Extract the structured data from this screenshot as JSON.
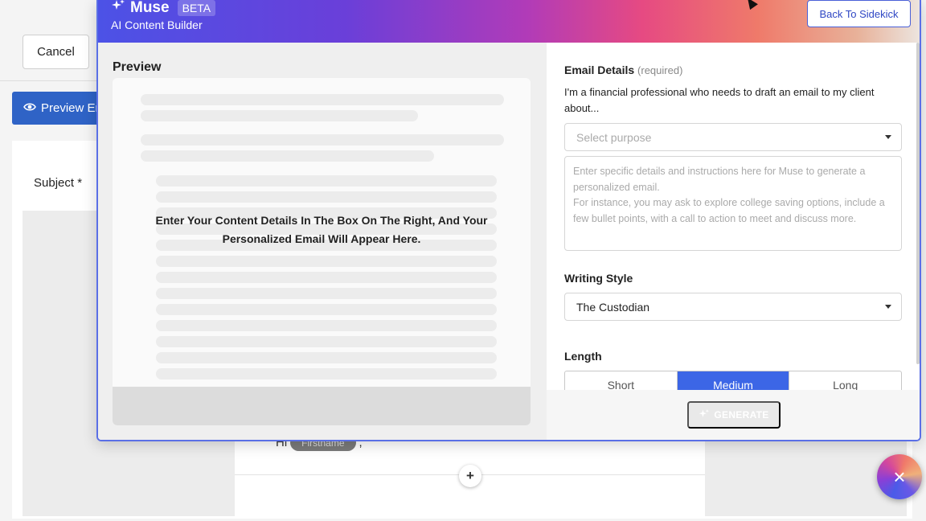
{
  "background": {
    "cancel_label": "Cancel",
    "preview_email_label": "Preview Em",
    "subject_label": "Subject *",
    "greeting": "Hi",
    "greeting_chip": "Firstname",
    "greeting_suffix": ","
  },
  "modal": {
    "brand_name": "Muse",
    "brand_badge": "BETA",
    "brand_subtitle": "AI Content Builder",
    "back_button_label": "Back To Sidekick",
    "preview": {
      "title": "Preview",
      "message": "Enter Your Content Details In The Box On The Right, And Your Personalized Email Will Appear Here."
    },
    "form": {
      "email_details_label": "Email Details",
      "email_details_required": "(required)",
      "intro_text": "I'm a financial professional who needs to draft an email to my client about...",
      "purpose_placeholder": "Select purpose",
      "details_placeholder_line1": "Enter specific details and instructions here for Muse to generate a personalized email.",
      "details_placeholder_line2": "For instance, you may ask to explore college saving options, include a few bullet points, with a call to action to meet and discuss more.",
      "writing_style_label": "Writing Style",
      "writing_style_value": "The Custodian",
      "length_label": "Length",
      "length_options": [
        "Short",
        "Medium",
        "Long"
      ],
      "length_selected": "Medium",
      "generate_label": "GENERATE"
    }
  },
  "colors": {
    "accent": "#3c66e6",
    "header_gradient_start": "#4c52e6",
    "header_gradient_end": "#ece7e2"
  }
}
